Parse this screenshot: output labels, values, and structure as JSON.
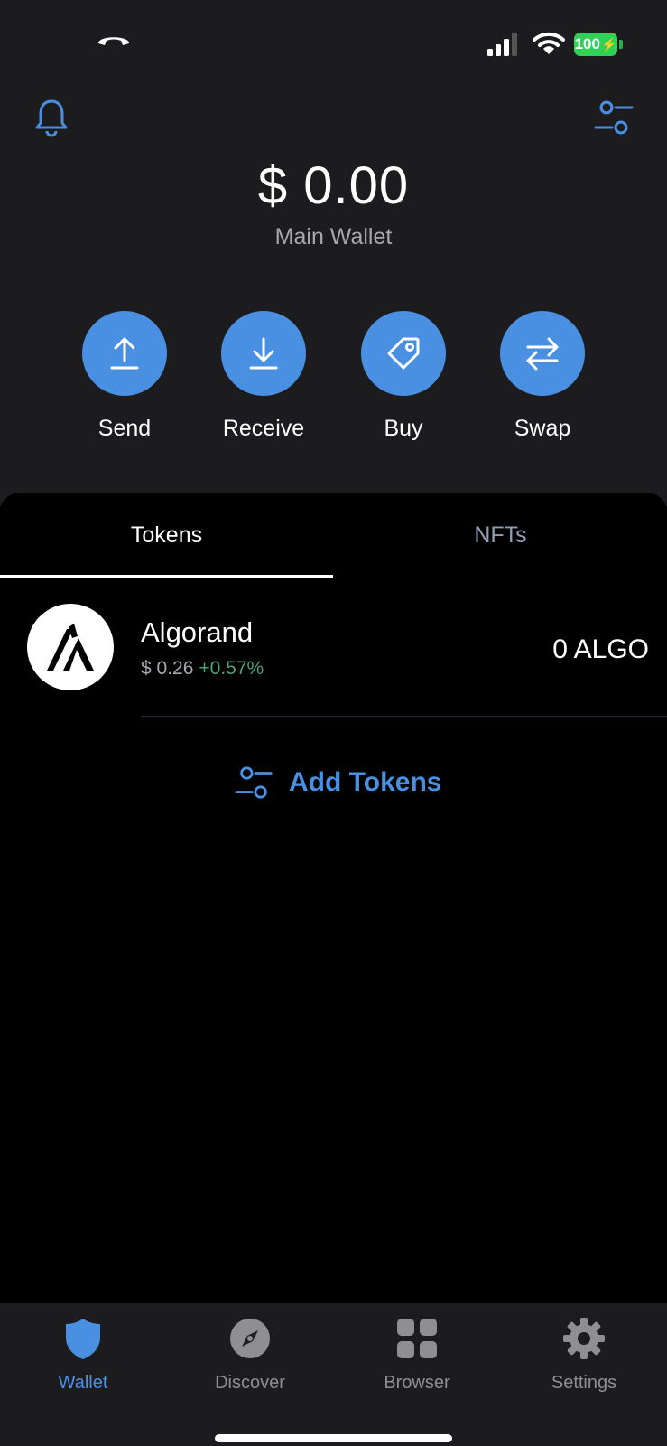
{
  "status_bar": {
    "battery": "100",
    "icons": [
      "phone-call-icon",
      "signal-icon",
      "wifi-icon",
      "battery-charging-icon"
    ]
  },
  "header": {
    "balance": "$ 0.00",
    "wallet_name": "Main Wallet",
    "icons": [
      "bell-icon",
      "sliders-icon"
    ]
  },
  "actions": [
    {
      "label": "Send",
      "icon": "upload-arrow-icon"
    },
    {
      "label": "Receive",
      "icon": "download-arrow-icon"
    },
    {
      "label": "Buy",
      "icon": "price-tag-icon"
    },
    {
      "label": "Swap",
      "icon": "swap-arrows-icon"
    }
  ],
  "tabs": [
    {
      "label": "Tokens",
      "selected": true
    },
    {
      "label": "NFTs",
      "selected": false
    }
  ],
  "tokens": [
    {
      "name": "Algorand",
      "price": "$ 0.26",
      "change": "+0.57%",
      "balance": "0 ALGO",
      "icon": "algorand-logo-icon"
    }
  ],
  "add_tokens": {
    "label": "Add Tokens",
    "icon": "sliders-icon"
  },
  "tab_bar": [
    {
      "label": "Wallet",
      "icon": "shield-icon",
      "active": true
    },
    {
      "label": "Discover",
      "icon": "compass-icon",
      "active": false
    },
    {
      "label": "Browser",
      "icon": "grid-icon",
      "active": false
    },
    {
      "label": "Settings",
      "icon": "gear-icon",
      "active": false
    }
  ],
  "colors": {
    "accent": "#4a90e2",
    "background_top": "#1c1c1e",
    "background": "#000000",
    "positive": "#4aa17a",
    "battery": "#31d158"
  }
}
